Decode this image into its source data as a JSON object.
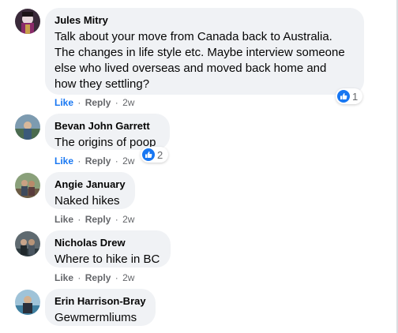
{
  "comments": [
    {
      "author": "Jules Mitry",
      "lines": [
        "Talk about your move from Canada back to Australia.",
        "The changes in life style etc. Maybe interview someone",
        "else who lived overseas and moved back home and",
        "how they settling?"
      ],
      "like_label": "Like",
      "reply_label": "Reply",
      "time": "2w",
      "reaction_count": "1",
      "reaction_icon": "like-thumb-icon"
    },
    {
      "author": "Bevan John Garrett",
      "lines": [
        "The origins of poop"
      ],
      "like_label": "Like",
      "reply_label": "Reply",
      "time": "2w",
      "reaction_count": "2",
      "reaction_icon": "like-thumb-icon"
    },
    {
      "author": "Angie January",
      "lines": [
        "Naked hikes"
      ],
      "like_label": "Like",
      "reply_label": "Reply",
      "time": "2w"
    },
    {
      "author": "Nicholas Drew",
      "lines": [
        "Where to hike in BC"
      ],
      "like_label": "Like",
      "reply_label": "Reply",
      "time": "2w"
    },
    {
      "author": "Erin Harrison-Bray",
      "lines": [
        "Gewmermliums"
      ]
    }
  ],
  "separator": "·",
  "colors": {
    "bubble_bg": "#f0f2f5",
    "text": "#050505",
    "secondary_text": "#65676b",
    "like_blue": "#1877f2"
  }
}
